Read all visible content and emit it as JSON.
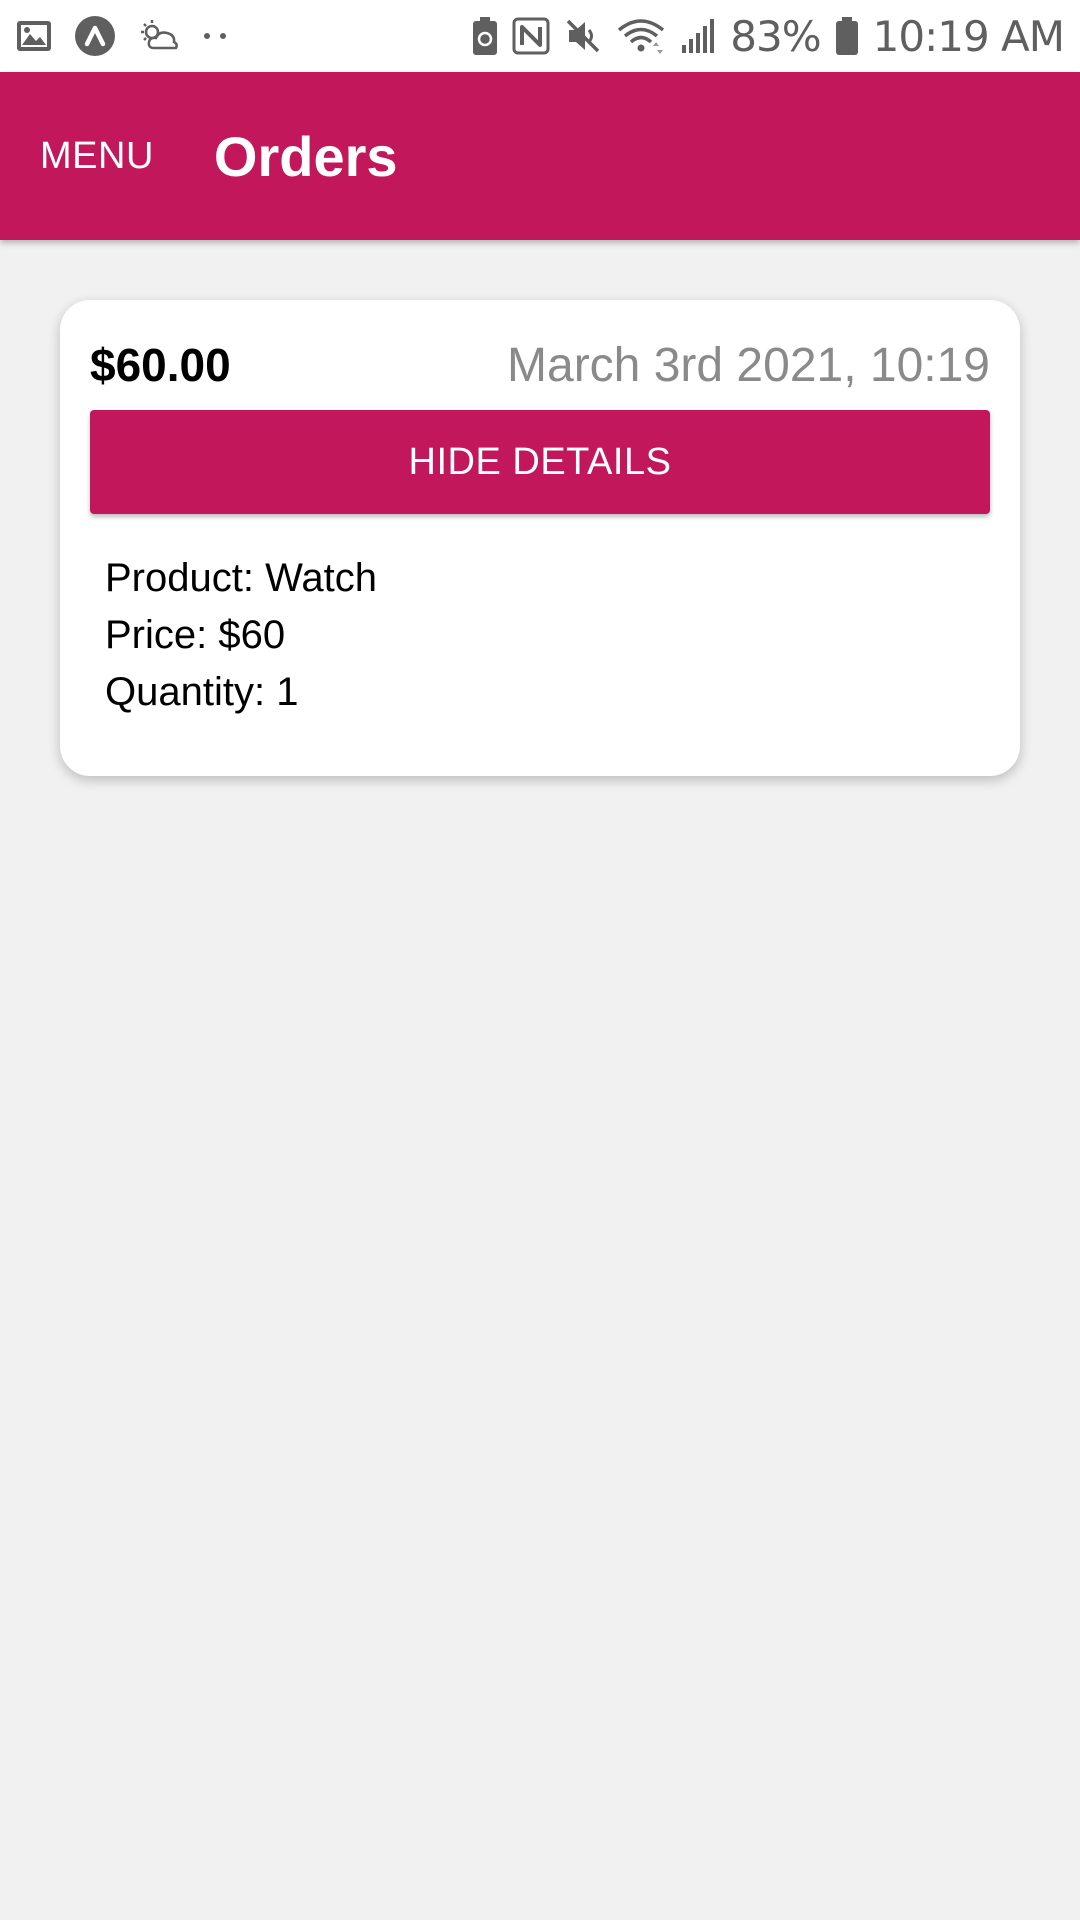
{
  "status_bar": {
    "icons": [
      "image-icon",
      "app-circle-icon",
      "cloud-sun-icon",
      "more-dots-icon",
      "battery-saver-icon",
      "nfc-icon",
      "mute-icon",
      "wifi-icon",
      "signal-icon",
      "battery-icon"
    ],
    "battery_percent": "83%",
    "time": "10:19 AM"
  },
  "app_bar": {
    "menu_label": "MENU",
    "title": "Orders",
    "color": "#c2185b"
  },
  "order": {
    "total": "$60.00",
    "date": "March 3rd 2021, 10:19",
    "toggle_label": "HIDE DETAILS",
    "details": {
      "product": "Product: Watch",
      "price": "Price: $60",
      "quantity": "Quantity: 1"
    }
  }
}
